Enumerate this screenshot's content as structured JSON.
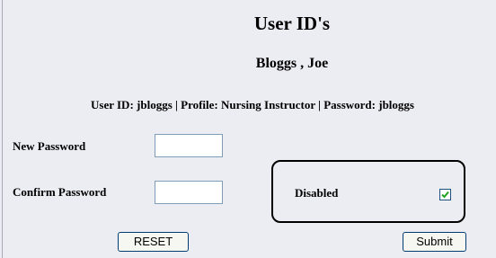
{
  "page": {
    "title": "User ID's",
    "user_name": "Bloggs , Joe",
    "user_info": "User ID: jbloggs | Profile: Nursing Instructor | Password: jbloggs"
  },
  "form": {
    "new_password_label": "New Password",
    "new_password_value": "",
    "confirm_password_label": "Confirm Password",
    "confirm_password_value": "",
    "disabled_label": "Disabled",
    "disabled_checked": true,
    "reset_label": "RESET",
    "submit_label": "Submit"
  },
  "colors": {
    "background": "#ececf3",
    "input_border": "#7f9db9",
    "button_border": "#003c74",
    "checkmark": "#21a121"
  },
  "icons": {
    "checkbox_mark": "checkmark-icon"
  }
}
